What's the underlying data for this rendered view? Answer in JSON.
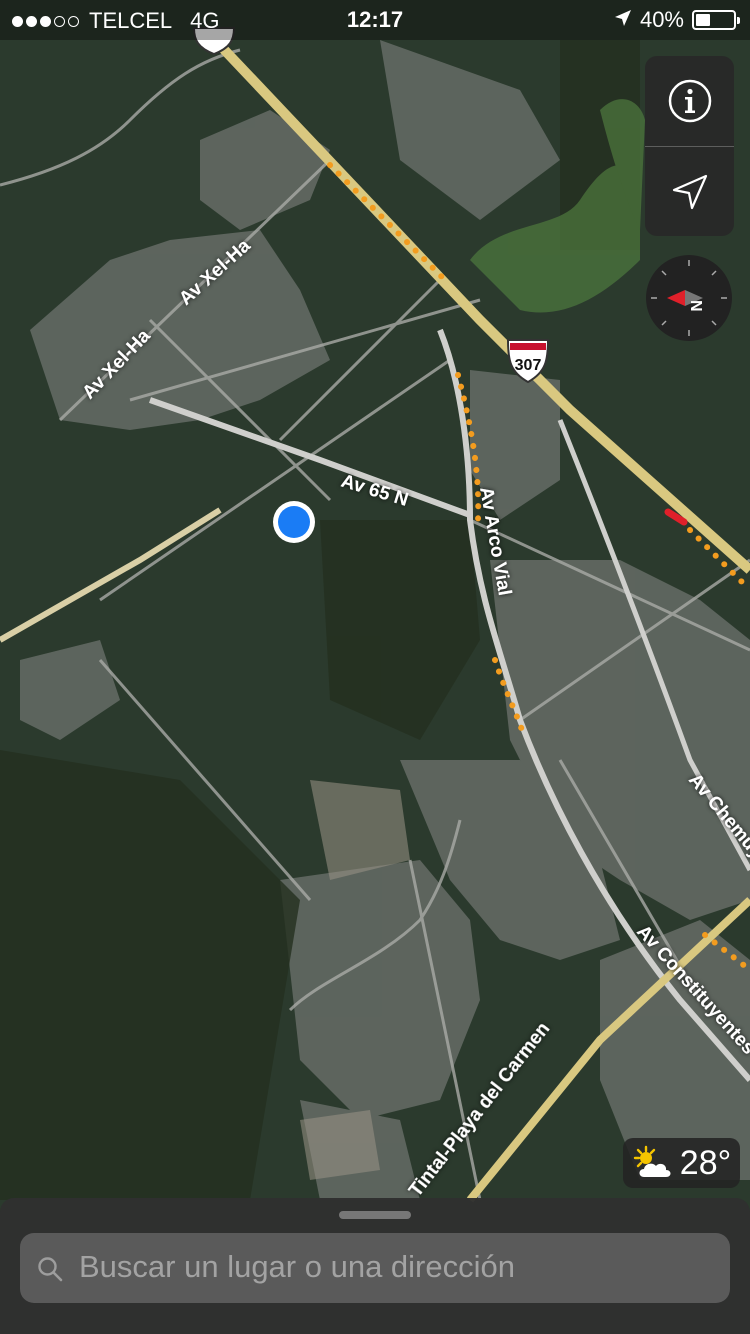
{
  "status_bar": {
    "signal_dots_filled": 3,
    "signal_dots_total": 5,
    "carrier": "TELCEL",
    "network": "4G",
    "time": "12:17",
    "location_icon": "location-arrow-icon",
    "battery_percent_text": "40%",
    "battery_level": 0.4
  },
  "map": {
    "style": "satellite",
    "roads": {
      "highway_shield": "307",
      "labels": [
        "Av Xel-Ha",
        "Av Xel-Ha",
        "Av 65 N",
        "Av Arco Vial",
        "Av Chemuy",
        "Av Constituyentes",
        "Tintal-Playa del Carmen"
      ]
    },
    "current_location_color": "#1a7cf5",
    "traffic_color": "#f39c1f"
  },
  "controls": {
    "info_icon": "info-icon",
    "tracking_icon": "location-tracking-icon",
    "compass_label": "N"
  },
  "weather": {
    "icon": "partly-cloudy-icon",
    "temperature": "28°"
  },
  "search": {
    "placeholder": "Buscar un lugar o una dirección"
  }
}
